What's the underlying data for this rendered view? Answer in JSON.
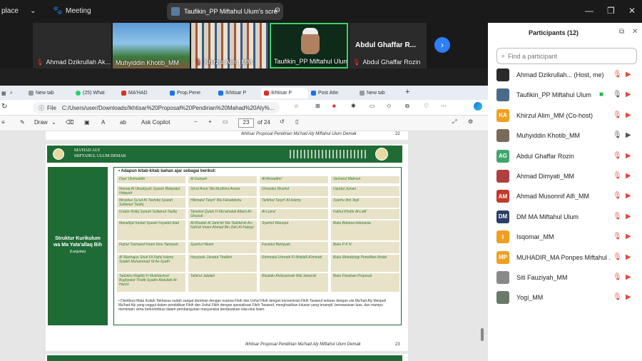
{
  "zoom": {
    "left_label": "place",
    "meeting_label": "Meeting",
    "share_label": "Taufikin_PP Miftahul Ulum's scre",
    "thumbnails": [
      {
        "name": "Ahmad Dzikrullah Ak..."
      },
      {
        "name": "Muhyiddin Khotib_MM"
      },
      {
        "name": "Khirzul Alim_MM"
      },
      {
        "name": "Taufikin_PP Miftahul Ulum"
      },
      {
        "name": "Abdul Ghaffar R...",
        "sub": "Abdul Ghaffar Rozin"
      }
    ]
  },
  "browser": {
    "tabs": [
      "New tab",
      "(25) What",
      "MA'HAD",
      "Prop.Pene",
      "Ikhtisar P",
      "Ikhtisar P",
      "Post Atte",
      "New tab"
    ],
    "address": {
      "file_label": "File",
      "url": "C:/Users/user/Downloads/Ikhtisar%20Proposal%20Pendirian%20Mahad%20Aly%..."
    },
    "pdf_toolbar": {
      "draw": "Draw",
      "ask_copilot": "Ask Copilot",
      "page_current": "23",
      "page_total": "of 24"
    }
  },
  "pdf": {
    "footer_top": "Ikhtisar Proposal Pendirian Ma'had Aly Miftahul Ulum Demak",
    "footer_top_num": "22",
    "header_line1": "MA'HAD ALY",
    "header_line2": "MIFTAHUL ULUM DEMAK",
    "side_title": "Struktur Kurikulum wa Ma Yata'allaq Bih",
    "side_sub": "(Lanjutan)",
    "table_heading": "Adapun kitab-kitab bahan ajar sebagai berikut:",
    "rows": [
      [
        "Diya' Ulumuddin",
        "Al Gunyah",
        "Al-Muwattho'",
        "Jauharul Maknun"
      ],
      [
        "Maroqi Al Ubudiyyah Syarah Bidayatul Hidayah",
        "Sirrul Asror Wa Mudhirul Anwar",
        "Ghoyatul Wushul",
        "Uqudul Juman"
      ],
      [
        "Mirqotus Su'ud At Tashdiq Syarah Sullamut Taufiq",
        "Hikmatut Tasyri' Wa Falsafatuhu",
        "Tarikhut Tasyri' Al-Islamy",
        "Syarhu Ibni 'Aqil"
      ],
      [
        "Is'adur Rofiq Syarah Sullamut Taufiq",
        "Tanwirul Qulub Fi Mu'amalati Allami Al-Ghuyub",
        "Al-Luma'",
        "Fathul Khobir Al-Latif"
      ],
      [
        "Manahijul Imdad Syarah Irsyadul Ibad",
        "Al-Risalah Al Jami'ah Wa Tadzkiroh An-Nafi'ah Imam Ahmad Bin Zain Al-Habsyi",
        "Syarhul Waroqot",
        "Buku Bahasa Indonesia"
      ],
      [
        "Fiqhut Tashawuf Imam Ibnu Taimiyah",
        "Syarhul Hikam",
        "Faroidul Bahiyyah",
        "Buku P K N"
      ],
      [
        "Al Manhajus Shufi Fil Fiqhil Islamy Syaikh Muhammad 'Id As-Syafi'i",
        "Hasyiyah J'anatut Thalibin",
        "Rohmatul Ummah Fi Ikhtilafil A'immah",
        "Buku Metodologi Penelitian Ilmiah"
      ],
      [
        "Tadzkiru Roghib Fi Mukhtashori Bughyatut Tholib Syaikh Abdullah Al-Harori",
        "Tafsirul Jalalain",
        "Risalatu Ahlissunnah Wal Jama'ah",
        "Buku Panduan Proposal"
      ]
    ],
    "note": "Distribusi Mata Kuliah Takhasus sudah sangat dominan dengan nuansa Fikih dan Ushul Fikih dengan konsentrasi Fikih Tasawuf selaras dengan visi Ma'had Aly Menjadi Ma'had Aly yang unggul dalam pendidikan Fikih dan Ushul Fikih dengan spesialisasi Fikih Tasawuf, menghasilkan lulusan yang terampil, berwawasan luas, dan mampu memimpin serta berkontribusi dalam pembangunan masyarakat berdasarkan nilai-nilai Islam",
    "footer_bottom": "Ikhtisar Proposal Pendirian Ma'had Aly Miftahul Ulum Demak",
    "footer_bottom_num": "23"
  },
  "participants": {
    "title": "Participants (12)",
    "search_placeholder": "Find a participant",
    "list": [
      {
        "name": "Ahmad Dzikrullah... (Host, me)",
        "initials": "",
        "color": "#2a2a2a"
      },
      {
        "name": "Taufikin_PP Miftahul Ulum",
        "initials": "",
        "color": "#4a6a8a"
      },
      {
        "name": "Khirzul Alim_MM (Co-host)",
        "initials": "KA",
        "color": "#f0a020"
      },
      {
        "name": "Muhyiddin Khotib_MM",
        "initials": "",
        "color": "#7a6a5a"
      },
      {
        "name": "Abdul Ghaffar Rozin",
        "initials": "AG",
        "color": "#3fa66b"
      },
      {
        "name": "Ahmad Dimyati_MM",
        "initials": "",
        "color": "#b04040"
      },
      {
        "name": "Ahmad Musonnif Alfi_MM",
        "initials": "AM",
        "color": "#c0392b"
      },
      {
        "name": "DM MA Miftahul Ulum",
        "initials": "DM",
        "color": "#2c3e6a"
      },
      {
        "name": "Isqomar_MM",
        "initials": "I",
        "color": "#f0a020"
      },
      {
        "name": "MUHADIR_MA Ponpes Miftahul ...",
        "initials": "MP",
        "color": "#f0a020"
      },
      {
        "name": "Siti Fauziyah_MM",
        "initials": "",
        "color": "#8a8a8a"
      },
      {
        "name": "Yogi_MM",
        "initials": "",
        "color": "#6a7a6a"
      }
    ]
  }
}
